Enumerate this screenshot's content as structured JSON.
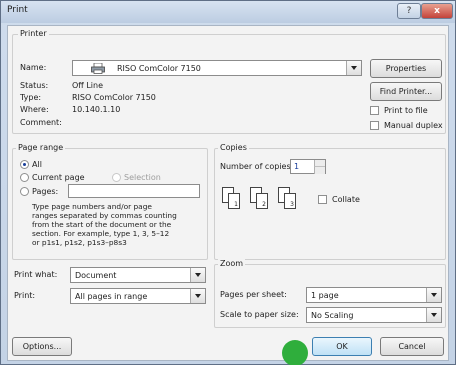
{
  "window": {
    "title": "Print",
    "help_label": "?",
    "close_label": "x"
  },
  "printer": {
    "group_title": "Printer",
    "name_label": "Name:",
    "name_value": "RISO ComColor 7150",
    "status_label": "Status:",
    "status_value": "Off Line",
    "type_label": "Type:",
    "type_value": "RISO ComColor 7150",
    "where_label": "Where:",
    "where_value": "10.140.1.10",
    "comment_label": "Comment:",
    "properties_label": "Properties",
    "find_printer_label": "Find Printer...",
    "print_to_file_label": "Print to file",
    "manual_duplex_label": "Manual duplex"
  },
  "page_range": {
    "group_title": "Page range",
    "all_label": "All",
    "current_page_label": "Current page",
    "selection_label": "Selection",
    "pages_label": "Pages:",
    "help_lines": [
      "Type page numbers and/or page",
      "ranges separated by commas counting",
      "from the start of the document or the",
      "section. For example, type 1, 3, 5–12",
      "or p1s1, p1s2, p1s3–p8s3"
    ]
  },
  "copies": {
    "group_title": "Copies",
    "number_label": "Number of copies:",
    "number_value": "1",
    "collate_label": "Collate",
    "pages": [
      "1",
      "2",
      "3"
    ]
  },
  "print_what": {
    "label": "Print what:",
    "value": "Document"
  },
  "print": {
    "label": "Print:",
    "value": "All pages in range"
  },
  "zoom": {
    "group_title": "Zoom",
    "pages_per_sheet_label": "Pages per sheet:",
    "pages_per_sheet_value": "1 page",
    "scale_label": "Scale to paper size:",
    "scale_value": "No Scaling"
  },
  "footer": {
    "options_label": "Options...",
    "ok_label": "OK",
    "cancel_label": "Cancel"
  }
}
